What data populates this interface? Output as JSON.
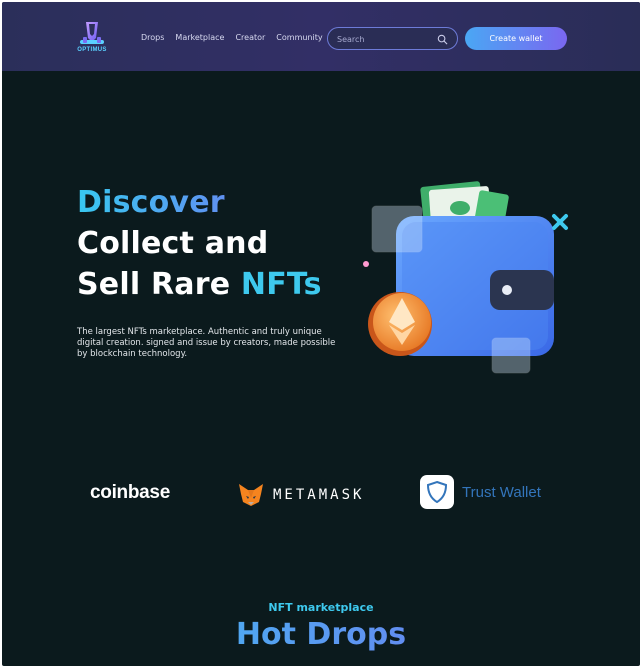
{
  "brand": {
    "name": "OPTIMUS"
  },
  "nav": {
    "items": [
      "Drops",
      "Marketplace",
      "Creator",
      "Community"
    ]
  },
  "search": {
    "placeholder": "Search"
  },
  "header": {
    "cta_label": "Create wallet"
  },
  "hero": {
    "title_line1": "Discover",
    "title_line2": "Collect and",
    "title_line3_prefix": "Sell Rare ",
    "title_line3_highlight": "NFTs",
    "description": "The largest NFTs marketplace. Authentic and truly unique digital creation. signed and issue by creators, made possible by blockchain technology."
  },
  "partners": {
    "coinbase": "coinbase",
    "metamask": "METAMASK",
    "trust": "Trust Wallet"
  },
  "section": {
    "label": "NFT marketplace",
    "title": "Hot Drops"
  },
  "colors": {
    "background": "#0b1a1d",
    "header": "#2f2f62",
    "accent_cyan": "#3ec9ee",
    "accent_purple": "#7a6cf2"
  }
}
